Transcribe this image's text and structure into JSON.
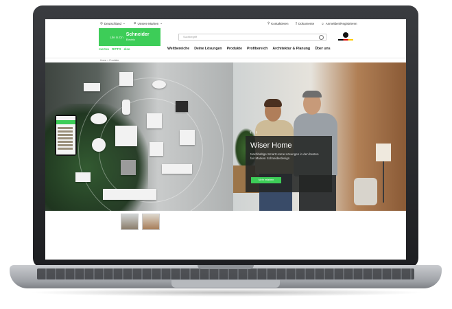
{
  "topbar": {
    "country": "Deutschland",
    "brands": "Unsere Marken",
    "contact": "Kontaktieren",
    "documents": "Dokumente",
    "login": "Anmelden/Registrieren"
  },
  "logo": {
    "tagline": "Life Is On",
    "brand": "Schneider",
    "brand_sub": "Electric",
    "sub_brands": [
      "merten",
      "RITTO",
      "elso"
    ]
  },
  "search": {
    "placeholder": "Suchbegriff"
  },
  "nav": {
    "items": [
      "Weltbereiche",
      "Deine Lösungen",
      "Produkte",
      "Profibereich",
      "Architektur & Planung",
      "Über uns"
    ]
  },
  "breadcrumb": "Home > Produkte",
  "hero": {
    "title": "Wiser Home",
    "text": "Nachhaltige Smart Home Lösungen in den besten fair Marken Schneiderdesign",
    "cta": "Mehr erfahren",
    "prev_icon": "chevron-left-icon",
    "next_icon": "chevron-right-icon"
  },
  "colors": {
    "accent": "#3dcd58",
    "card_bg": "#232624",
    "laptop": "#1d1e21"
  }
}
